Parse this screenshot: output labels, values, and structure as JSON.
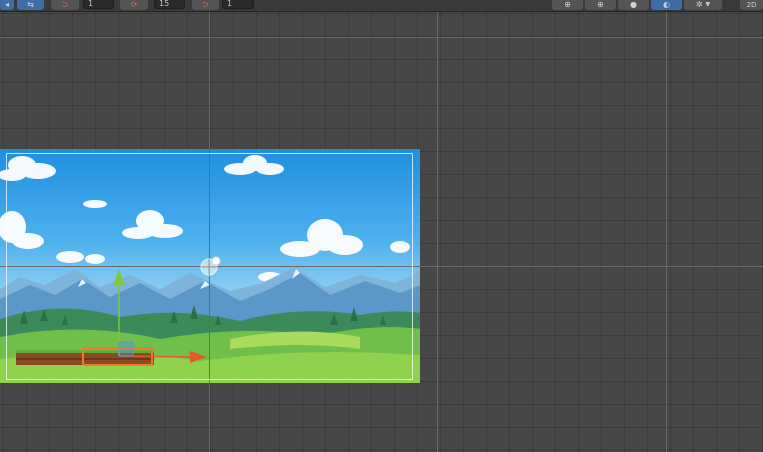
{
  "toolbar": {
    "snap_value_1": "1",
    "snap_value_2": "15",
    "snap_value_3": "1",
    "right_label": "2D"
  },
  "icons": {
    "move_tool": "move-icon",
    "magnet_1": "magnet-icon",
    "rotate_snap": "rotate-snap-icon",
    "scale_snap": "scale-snap-icon",
    "globe": "globe-icon",
    "wire_globe": "wireframe-globe-icon",
    "shaded": "shaded-sphere-icon",
    "lighting": "lighting-icon",
    "bug": "bug-icon"
  },
  "colors": {
    "accent": "#3d6da8",
    "selection": "#f07a2a",
    "y_axis": "#7ec83a",
    "x_axis": "#e25a28"
  }
}
